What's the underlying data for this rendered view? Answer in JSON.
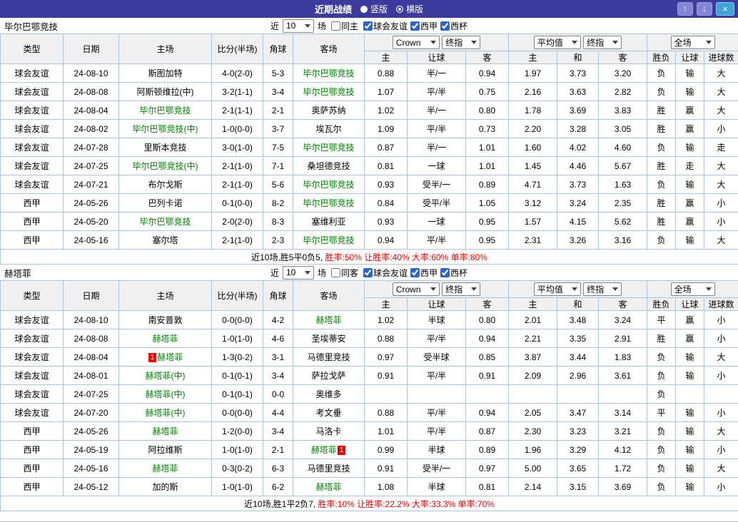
{
  "titlebar": {
    "title": "近期战绩",
    "radios": [
      {
        "label": "竖版",
        "selected": false
      },
      {
        "label": "横版",
        "selected": true
      }
    ],
    "up_icon": "↑",
    "down_icon": "↓",
    "close_icon": "×"
  },
  "filter_labels": {
    "near": "近",
    "games": "场"
  },
  "table_header": {
    "static_cols": [
      "类型",
      "日期",
      "主场",
      "比分(半场)",
      "角球",
      "客场"
    ],
    "crow_select": "Crown",
    "final_select": "终指",
    "avg_select": "平均值",
    "final2_select": "终指",
    "full_select": "全场",
    "odds_sub": [
      "主",
      "让球",
      "客"
    ],
    "avg_sub": [
      "主",
      "和",
      "客"
    ],
    "result_sub": [
      "胜负",
      "让球",
      "进球数"
    ]
  },
  "colors": {
    "titlebar_purple": "#3B3B9C",
    "friendly_teal": "#00A8A8",
    "laliga_green": "#1E851E",
    "score_red": "#E60000",
    "team_highlight_green": "#008000",
    "win_red": "#E60000",
    "draw_green": "#008000",
    "lose_blue": "#0000D0"
  },
  "sections": [
    {
      "team": "毕尔巴鄂竞技",
      "near_count": "10",
      "same_side": {
        "label": "同主",
        "checked": false
      },
      "league_filters": [
        {
          "label": "球会友谊",
          "checked": true
        },
        {
          "label": "西甲",
          "checked": true
        },
        {
          "label": "西杯",
          "checked": true
        }
      ],
      "rows": [
        {
          "league": "球会友谊",
          "league_style": "friendly",
          "date": "24-08-10",
          "home": "斯图加特",
          "home_hl": false,
          "score": "4-0(2-0)",
          "corner": "5-3",
          "away": "毕尔巴鄂竞技",
          "away_hl": true,
          "crow": [
            "0.88",
            "半/一",
            "0.94"
          ],
          "avg": [
            "1.97",
            "3.73",
            "3.20"
          ],
          "res": [
            "负",
            "输",
            "大"
          ]
        },
        {
          "league": "球会友谊",
          "league_style": "friendly",
          "date": "24-08-08",
          "home": "阿斯顿维拉(中)",
          "home_hl": false,
          "score": "3-2(1-1)",
          "corner": "3-4",
          "away": "毕尔巴鄂竞技",
          "away_hl": true,
          "crow": [
            "1.07",
            "平/半",
            "0.75"
          ],
          "avg": [
            "2.16",
            "3.63",
            "2.82"
          ],
          "res": [
            "负",
            "输",
            "大"
          ]
        },
        {
          "league": "球会友谊",
          "league_style": "friendly",
          "date": "24-08-04",
          "home": "毕尔巴鄂竞技",
          "home_hl": true,
          "score": "2-1(1-1)",
          "corner": "2-1",
          "away": "奥萨苏纳",
          "away_hl": false,
          "crow": [
            "1.02",
            "半/一",
            "0.80"
          ],
          "avg": [
            "1.78",
            "3.69",
            "3.83"
          ],
          "res": [
            "胜",
            "赢",
            "大"
          ]
        },
        {
          "league": "球会友谊",
          "league_style": "friendly",
          "date": "24-08-02",
          "home": "毕尔巴鄂竞技(中)",
          "home_hl": true,
          "score": "1-0(0-0)",
          "corner": "3-7",
          "away": "埃瓦尔",
          "away_hl": false,
          "crow": [
            "1.09",
            "平/半",
            "0.73"
          ],
          "avg": [
            "2.20",
            "3.28",
            "3.05"
          ],
          "res": [
            "胜",
            "赢",
            "小"
          ]
        },
        {
          "league": "球会友谊",
          "league_style": "friendly",
          "date": "24-07-28",
          "home": "里斯本竞技",
          "home_hl": false,
          "score": "3-0(1-0)",
          "corner": "7-5",
          "away": "毕尔巴鄂竞技",
          "away_hl": true,
          "crow": [
            "0.87",
            "半/一",
            "1.01"
          ],
          "avg": [
            "1.60",
            "4.02",
            "4.60"
          ],
          "res": [
            "负",
            "输",
            "走"
          ]
        },
        {
          "league": "球会友谊",
          "league_style": "friendly",
          "date": "24-07-25",
          "home": "毕尔巴鄂竞技(中)",
          "home_hl": true,
          "score": "2-1(1-0)",
          "corner": "7-1",
          "away": "桑坦德竞技",
          "away_hl": false,
          "crow": [
            "0.81",
            "一球",
            "1.01"
          ],
          "avg": [
            "1.45",
            "4.46",
            "5.67"
          ],
          "res": [
            "胜",
            "走",
            "大"
          ]
        },
        {
          "league": "球会友谊",
          "league_style": "friendly",
          "date": "24-07-21",
          "home": "布尔戈斯",
          "home_hl": false,
          "score": "2-1(1-0)",
          "corner": "5-6",
          "away": "毕尔巴鄂竞技",
          "away_hl": true,
          "crow": [
            "0.93",
            "受半/一",
            "0.89"
          ],
          "avg": [
            "4.71",
            "3.73",
            "1.63"
          ],
          "res": [
            "负",
            "输",
            "大"
          ]
        },
        {
          "league": "西甲",
          "league_style": "liga",
          "date": "24-05-26",
          "home": "巴列卡诺",
          "home_hl": false,
          "score": "0-1(0-0)",
          "corner": "8-2",
          "away": "毕尔巴鄂竞技",
          "away_hl": true,
          "crow": [
            "0.84",
            "受平/半",
            "1.05"
          ],
          "avg": [
            "3.12",
            "3.24",
            "2.35"
          ],
          "res": [
            "胜",
            "赢",
            "小"
          ]
        },
        {
          "league": "西甲",
          "league_style": "liga",
          "date": "24-05-20",
          "home": "毕尔巴鄂竞技",
          "home_hl": true,
          "score": "2-0(2-0)",
          "corner": "8-3",
          "away": "塞维利亚",
          "away_hl": false,
          "crow": [
            "0.93",
            "一球",
            "0.95"
          ],
          "avg": [
            "1.57",
            "4.15",
            "5.62"
          ],
          "res": [
            "胜",
            "赢",
            "小"
          ]
        },
        {
          "league": "西甲",
          "league_style": "liga",
          "date": "24-05-16",
          "home": "塞尔塔",
          "home_hl": false,
          "score": "2-1(1-0)",
          "corner": "2-3",
          "away": "毕尔巴鄂竞技",
          "away_hl": true,
          "crow": [
            "0.94",
            "平/半",
            "0.95"
          ],
          "avg": [
            "2.31",
            "3.26",
            "3.16"
          ],
          "res": [
            "负",
            "输",
            "大"
          ]
        }
      ],
      "summary_plain": "近10场,胜5平0负5,",
      "summary_red": "胜率:50% 让胜率:40% 大率:60% 单率:80%"
    },
    {
      "team": "赫塔菲",
      "near_count": "10",
      "same_side": {
        "label": "同客",
        "checked": false
      },
      "league_filters": [
        {
          "label": "球会友谊",
          "checked": true
        },
        {
          "label": "西甲",
          "checked": true
        },
        {
          "label": "西杯",
          "checked": true
        }
      ],
      "rows": [
        {
          "league": "球会友谊",
          "league_style": "friendly",
          "date": "24-08-10",
          "home": "南安普敦",
          "home_hl": false,
          "score": "0-0(0-0)",
          "corner": "4-2",
          "away": "赫塔菲",
          "away_hl": true,
          "crow": [
            "1.02",
            "半球",
            "0.80"
          ],
          "avg": [
            "2.01",
            "3.48",
            "3.24"
          ],
          "res": [
            "平",
            "赢",
            "小"
          ]
        },
        {
          "league": "球会友谊",
          "league_style": "friendly",
          "date": "24-08-08",
          "home": "赫塔菲",
          "home_hl": true,
          "score": "1-0(1-0)",
          "corner": "4-6",
          "away": "圣埃蒂安",
          "away_hl": false,
          "crow": [
            "0.88",
            "平/半",
            "0.94"
          ],
          "avg": [
            "2.21",
            "3.35",
            "2.91"
          ],
          "res": [
            "胜",
            "赢",
            "小"
          ]
        },
        {
          "league": "球会友谊",
          "league_style": "friendly",
          "date": "24-08-04",
          "home": "赫塔菲",
          "home_hl": true,
          "home_badge": "1",
          "home_badge_pos": "pre",
          "score": "1-3(0-2)",
          "corner": "3-1",
          "away": "马德里竞技",
          "away_hl": false,
          "crow": [
            "0.97",
            "受半球",
            "0.85"
          ],
          "avg": [
            "3.87",
            "3.44",
            "1.83"
          ],
          "res": [
            "负",
            "输",
            "大"
          ]
        },
        {
          "league": "球会友谊",
          "league_style": "friendly",
          "date": "24-08-01",
          "home": "赫塔菲(中)",
          "home_hl": true,
          "score": "0-1(0-1)",
          "corner": "3-4",
          "away": "萨拉戈萨",
          "away_hl": false,
          "crow": [
            "0.91",
            "平/半",
            "0.91"
          ],
          "avg": [
            "2.09",
            "2.96",
            "3.61"
          ],
          "res": [
            "负",
            "输",
            "小"
          ]
        },
        {
          "league": "球会友谊",
          "league_style": "friendly",
          "date": "24-07-25",
          "home": "赫塔菲(中)",
          "home_hl": true,
          "score": "0-1(0-1)",
          "corner": "0-0",
          "away": "奥维多",
          "away_hl": false,
          "crow": [
            "",
            "",
            ""
          ],
          "avg": [
            "",
            "",
            ""
          ],
          "res": [
            "负",
            "",
            ""
          ]
        },
        {
          "league": "球会友谊",
          "league_style": "friendly",
          "date": "24-07-20",
          "home": "赫塔菲(中)",
          "home_hl": true,
          "score": "0-0(0-0)",
          "corner": "4-4",
          "away": "考文垂",
          "away_hl": false,
          "crow": [
            "0.88",
            "平/半",
            "0.94"
          ],
          "avg": [
            "2.05",
            "3.47",
            "3.14"
          ],
          "res": [
            "平",
            "输",
            "小"
          ]
        },
        {
          "league": "西甲",
          "league_style": "liga",
          "date": "24-05-26",
          "home": "赫塔菲",
          "home_hl": true,
          "score": "1-2(0-0)",
          "corner": "3-4",
          "away": "马洛卡",
          "away_hl": false,
          "crow": [
            "1.01",
            "平/半",
            "0.87"
          ],
          "avg": [
            "2.30",
            "3.23",
            "3.21"
          ],
          "res": [
            "负",
            "输",
            "大"
          ]
        },
        {
          "league": "西甲",
          "league_style": "liga",
          "date": "24-05-19",
          "home": "阿拉维斯",
          "home_hl": false,
          "score": "1-0(1-0)",
          "corner": "2-1",
          "away": "赫塔菲",
          "away_hl": true,
          "away_badge": "1",
          "away_badge_pos": "post",
          "crow": [
            "0.99",
            "半球",
            "0.89"
          ],
          "avg": [
            "1.96",
            "3.29",
            "4.12"
          ],
          "res": [
            "负",
            "输",
            "小"
          ]
        },
        {
          "league": "西甲",
          "league_style": "liga",
          "date": "24-05-16",
          "home": "赫塔菲",
          "home_hl": true,
          "score": "0-3(0-2)",
          "corner": "6-3",
          "away": "马德里竞技",
          "away_hl": false,
          "crow": [
            "0.91",
            "受半/一",
            "0.97"
          ],
          "avg": [
            "5.00",
            "3.65",
            "1.72"
          ],
          "res": [
            "负",
            "输",
            "大"
          ]
        },
        {
          "league": "西甲",
          "league_style": "liga",
          "date": "24-05-12",
          "home": "加的斯",
          "home_hl": false,
          "score": "1-0(1-0)",
          "corner": "6-2",
          "away": "赫塔菲",
          "away_hl": true,
          "crow": [
            "1.08",
            "半球",
            "0.81"
          ],
          "avg": [
            "2.14",
            "3.15",
            "3.69"
          ],
          "res": [
            "负",
            "输",
            "小"
          ]
        }
      ],
      "summary_plain": "近10场,胜1平2负7,",
      "summary_red": "胜率:10% 让胜率:22.2% 大率:33.3% 单率:70%"
    }
  ]
}
